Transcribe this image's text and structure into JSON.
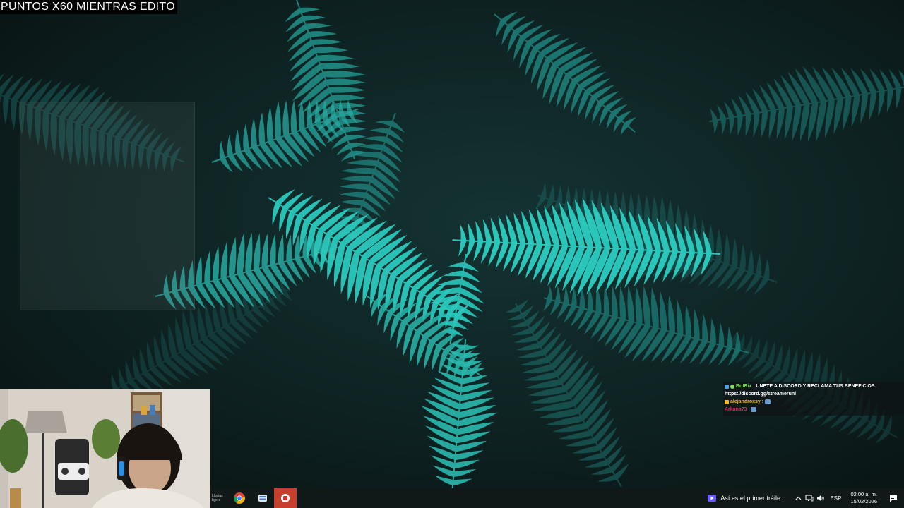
{
  "banner": {
    "text": "PUNTOS X60 MIENTRAS EDITO"
  },
  "chat": {
    "messages": [
      {
        "user": "BotRix",
        "user_color": "#7ee05b",
        "text": "UNETE A DISCORD Y RECLAMA TUS BENEFICIOS:",
        "text2": "https://discord.gg/streameruni"
      },
      {
        "user": "alejandroxsy",
        "user_color": "#f5b73b",
        "text": ""
      },
      {
        "user": "Arkana73",
        "user_color": "#e0245e",
        "text": ""
      }
    ]
  },
  "taskbar": {
    "widget_label": "Lluvias ligera",
    "media_title": "Así es el primer tráile...",
    "language": "ESP",
    "time": "02:00 a. m.",
    "date": "15/02/2026"
  },
  "icons": {
    "browser": "chrome-icon",
    "app1": "task-view-icon",
    "app2": "red-app-icon",
    "media": "media-play-icon",
    "chevron": "chevron-up-icon",
    "network": "network-icon",
    "volume": "volume-icon",
    "notifications": "notification-icon"
  },
  "colors": {
    "fern": "#2bc9bd",
    "bg": "#0d1a1a",
    "taskbar": "#101818"
  }
}
